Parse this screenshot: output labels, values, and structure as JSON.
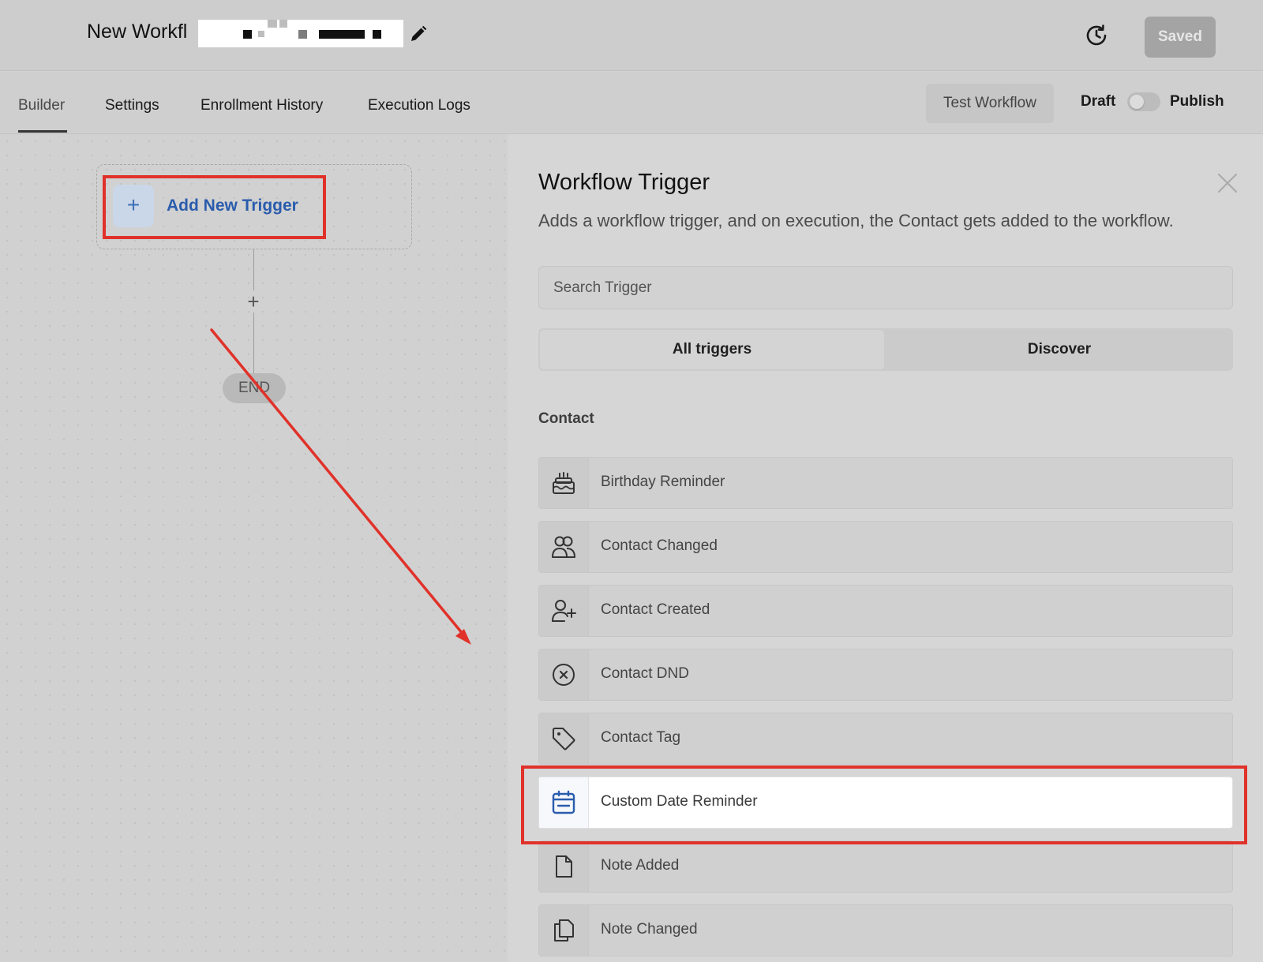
{
  "header": {
    "title": "New Workfl",
    "saved_label": "Saved"
  },
  "tabs": [
    {
      "label": "Builder",
      "active": true
    },
    {
      "label": "Settings",
      "active": false
    },
    {
      "label": "Enrollment History",
      "active": false
    },
    {
      "label": "Execution Logs",
      "active": false
    }
  ],
  "actions": {
    "test_workflow": "Test Workflow",
    "draft": "Draft",
    "publish": "Publish",
    "publish_toggle_on": false
  },
  "canvas": {
    "add_trigger_icon": "+",
    "add_trigger_label": "Add New Trigger",
    "add_step_icon": "+",
    "end_label": "END"
  },
  "panel": {
    "title": "Workflow Trigger",
    "description": "Adds a workflow trigger, and on execution, the Contact gets added to the workflow.",
    "search_placeholder": "Search Trigger",
    "filter_tabs": [
      "All triggers",
      "Discover"
    ],
    "section_title": "Contact",
    "triggers": [
      {
        "label": "Birthday Reminder",
        "icon": "cake-icon"
      },
      {
        "label": "Contact Changed",
        "icon": "users-icon"
      },
      {
        "label": "Contact Created",
        "icon": "user-plus-icon"
      },
      {
        "label": "Contact DND",
        "icon": "circle-x-icon"
      },
      {
        "label": "Contact Tag",
        "icon": "tag-icon"
      },
      {
        "label": "Custom Date Reminder",
        "icon": "calendar-icon",
        "highlighted": true
      },
      {
        "label": "Note Added",
        "icon": "file-icon"
      },
      {
        "label": "Note Changed",
        "icon": "files-icon"
      }
    ]
  },
  "colors": {
    "accent": "#2a5cad",
    "annotation": "#e0322a",
    "overlay_gray": "#d3d3d3"
  }
}
